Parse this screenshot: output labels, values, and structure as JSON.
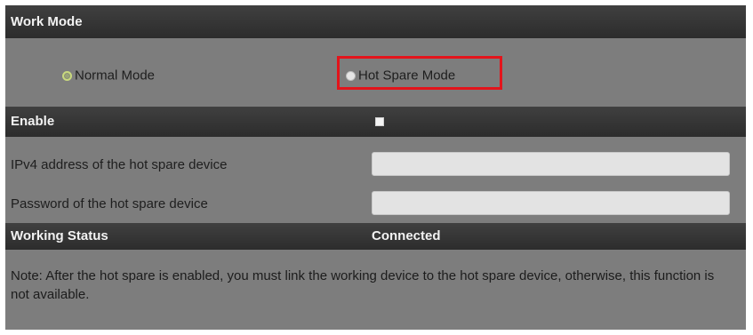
{
  "work_mode": {
    "title": "Work Mode",
    "normal_mode_label": "Normal Mode",
    "hot_spare_mode_label": "Hot Spare Mode",
    "selected": "Normal Mode"
  },
  "enable": {
    "label": "Enable",
    "checked": false
  },
  "ipv4": {
    "label": "IPv4 address of the hot spare device",
    "value": ""
  },
  "password": {
    "label": "Password of the hot spare device",
    "value": ""
  },
  "working_status": {
    "label": "Working Status",
    "value": "Connected"
  },
  "note": {
    "text": "Note: After the hot spare is enabled, you must link the working device to the hot spare device, otherwise, this function is not available."
  },
  "colors": {
    "panel_bg": "#7d7d7d",
    "header_bg": "#333333",
    "highlight": "#e3141b",
    "radio_selected": "#c9d97e"
  }
}
